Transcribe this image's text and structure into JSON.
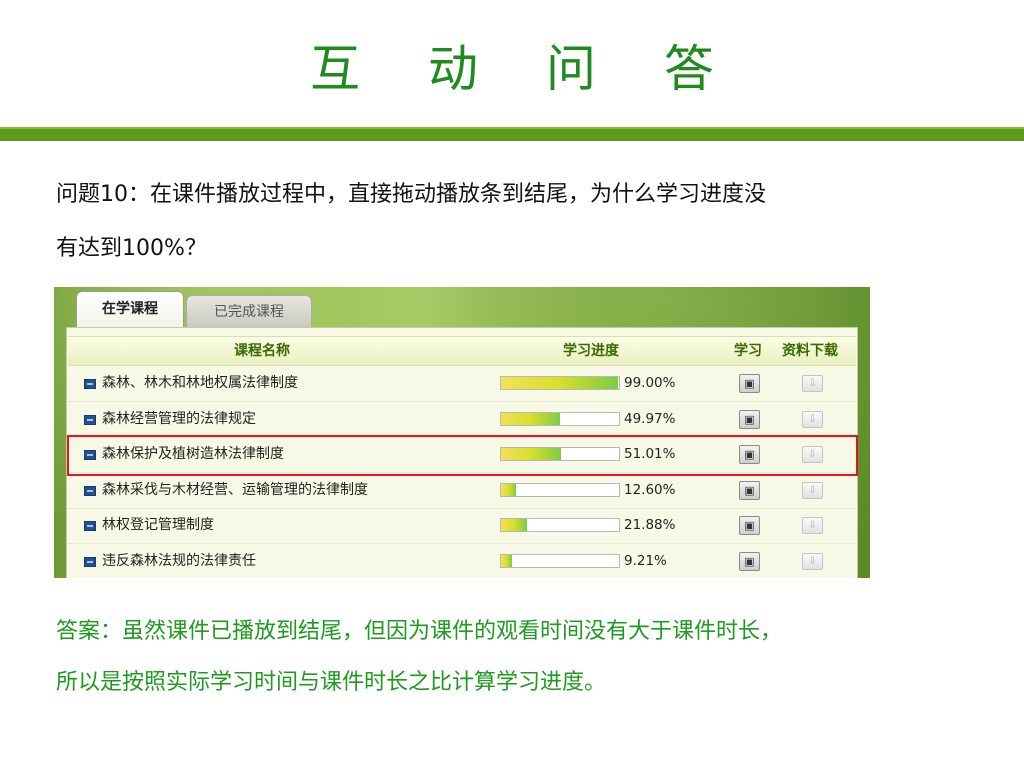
{
  "slide": {
    "title": "互 动 问 答",
    "question_line1": "问题10：在课件播放过程中，直接拖动播放条到结尾，为什么学习进度没",
    "question_line2": "有达到100%？",
    "answer_line1": "答案：虽然课件已播放到结尾，但因为课件的观看时间没有大于课件时长，",
    "answer_line2": "所以是按照实际学习时间与课件时长之比计算学习进度。"
  },
  "screenshot": {
    "tabs": [
      {
        "label": "在学课程",
        "active": true
      },
      {
        "label": "已完成课程",
        "active": false
      }
    ],
    "headers": {
      "name": "课程名称",
      "progress": "学习进度",
      "study": "学习",
      "download": "资料下载"
    },
    "rows": [
      {
        "name": "森林、林木和林地权属法律制度",
        "progress": 99.0,
        "progress_label": "99.00%"
      },
      {
        "name": "森林经营管理的法律规定",
        "progress": 49.97,
        "progress_label": "49.97%"
      },
      {
        "name": "森林保护及植树造林法律制度",
        "progress": 51.01,
        "progress_label": "51.01%",
        "highlighted": true
      },
      {
        "name": "森林采伐与木材经营、运输管理的法律制度",
        "progress": 12.6,
        "progress_label": "12.60%"
      },
      {
        "name": "林权登记管理制度",
        "progress": 21.88,
        "progress_label": "21.88%"
      },
      {
        "name": "违反森林法规的法律责任",
        "progress": 9.21,
        "progress_label": "9.21%"
      }
    ],
    "icons": {
      "study": "tv-icon",
      "download": "download-arrow-icon",
      "course": "course-book-icon"
    },
    "colors": {
      "highlight": "#e3151b",
      "title": "#1f8a1f",
      "answer": "#1f9a1f",
      "bar_fill_end": "#7ccc45"
    }
  }
}
